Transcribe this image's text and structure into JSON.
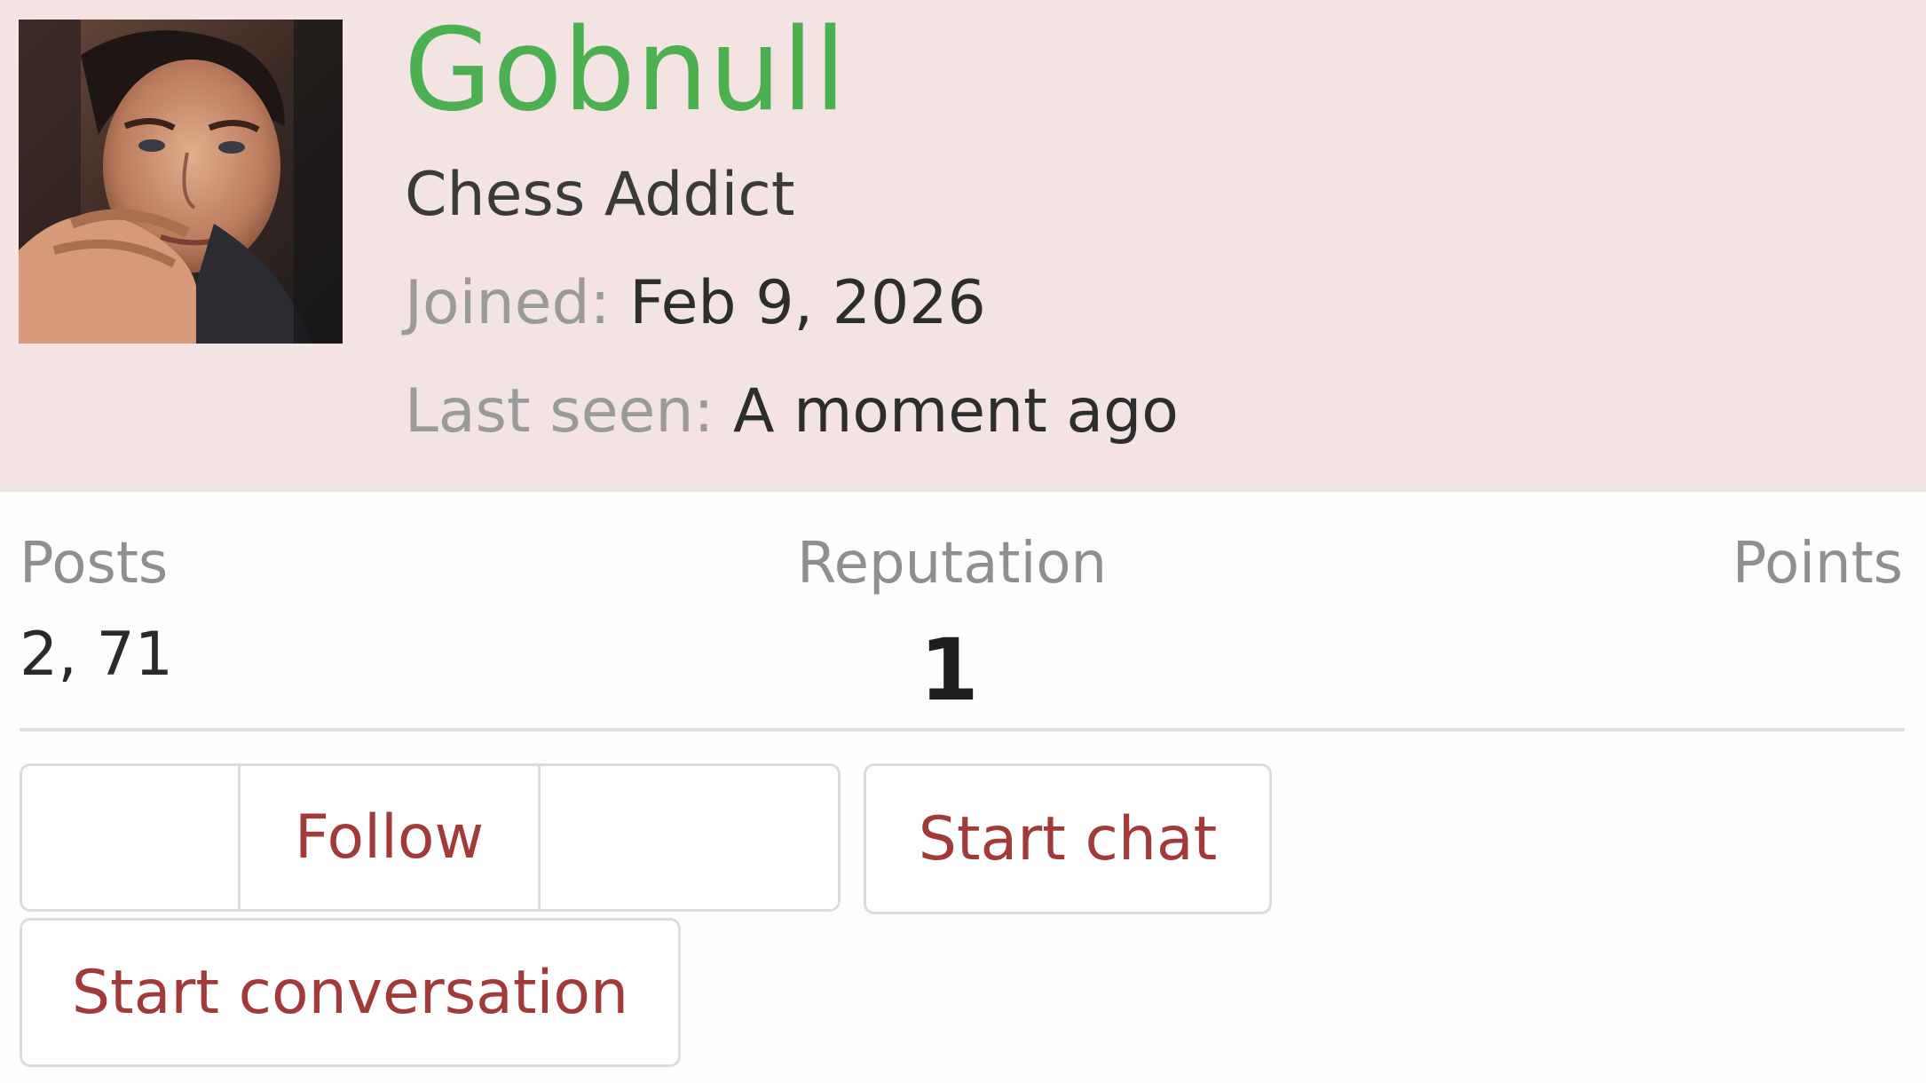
{
  "profile": {
    "username": "Gobnull",
    "title": "Chess Addict",
    "joined_label": "Joined:",
    "joined_value": "Feb 9, 2026",
    "last_seen_label": "Last seen:",
    "last_seen_value": "A moment ago",
    "username_color": "#4cb050"
  },
  "stats": {
    "posts_label": "Posts",
    "posts_value": "2,  71",
    "reputation_label": "Reputation",
    "reputation_value": "1",
    "points_label": "Points"
  },
  "actions": {
    "follow_label": "Follow",
    "start_chat_label": "Start chat",
    "start_conversation_label": "Start conversation",
    "accent_color": "#a33a3a"
  },
  "icons": {
    "avatar": "user-avatar-photo"
  }
}
